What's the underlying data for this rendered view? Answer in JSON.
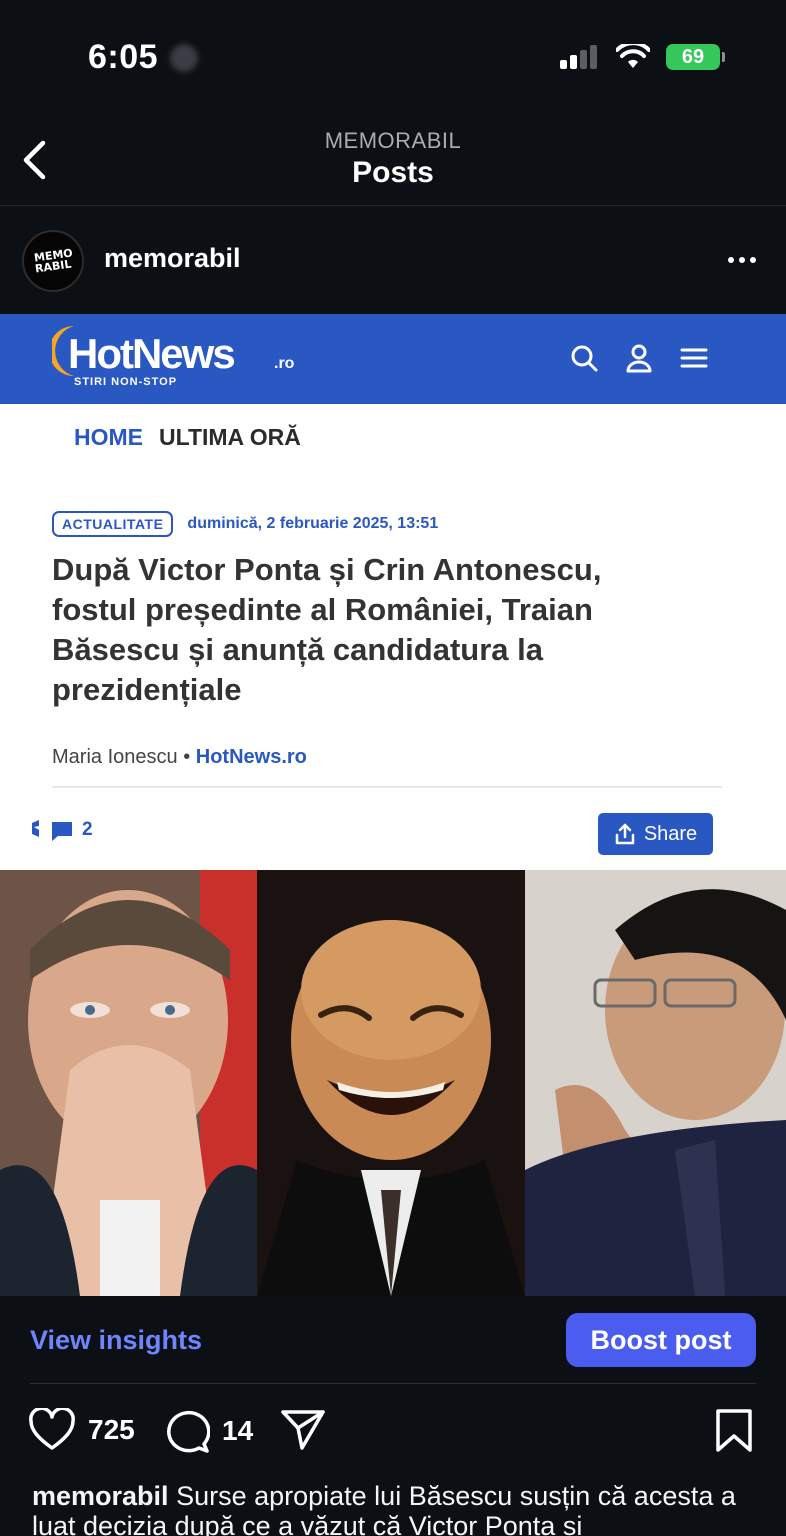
{
  "status_bar": {
    "time": "6:05",
    "battery": "69"
  },
  "nav": {
    "subtitle": "MEMORABIL",
    "title": "Posts"
  },
  "post": {
    "username": "memorabil",
    "avatar_text": [
      "MEMO",
      "RABIL"
    ],
    "article": {
      "brand": "HotNews",
      "brand_suffix": ".ro",
      "tagline": "STIRI NON-STOP",
      "nav_home": "HOME",
      "nav_latest": "ULTIMA ORĂ",
      "tag": "ACTUALITATE",
      "date": "duminică, 2 februarie 2025, 13:51",
      "headline": "După Victor Ponta și Crin Antonescu, fostul președinte al României, Traian Băsescu și anunță candidatura la prezidențiale",
      "author": "Maria Ionescu",
      "byline_sep": "•",
      "source": "HotNews.ro",
      "comments_count": "2",
      "share_label": "Share"
    },
    "insights_label": "View insights",
    "boost_label": "Boost post",
    "likes": "725",
    "comments": "14",
    "caption_user": "memorabil",
    "caption_text": "Surse apropiate lui Băsescu susțin că acesta a luat decizia după ce a văzut că Victor Ponta și"
  },
  "colors": {
    "background": "#0c1014",
    "hotnews_blue": "#2a58c3",
    "insights_link": "#6d86ff",
    "boost_button": "#4a5df0",
    "battery": "#34c759"
  },
  "icons": [
    "back-chevron-icon",
    "more-dots-icon",
    "search-icon",
    "user-icon",
    "menu-icon",
    "comment-icon",
    "share-upload-icon",
    "heart-icon",
    "comment-bubble-icon",
    "send-icon",
    "bookmark-icon",
    "signal-icon",
    "wifi-icon"
  ]
}
